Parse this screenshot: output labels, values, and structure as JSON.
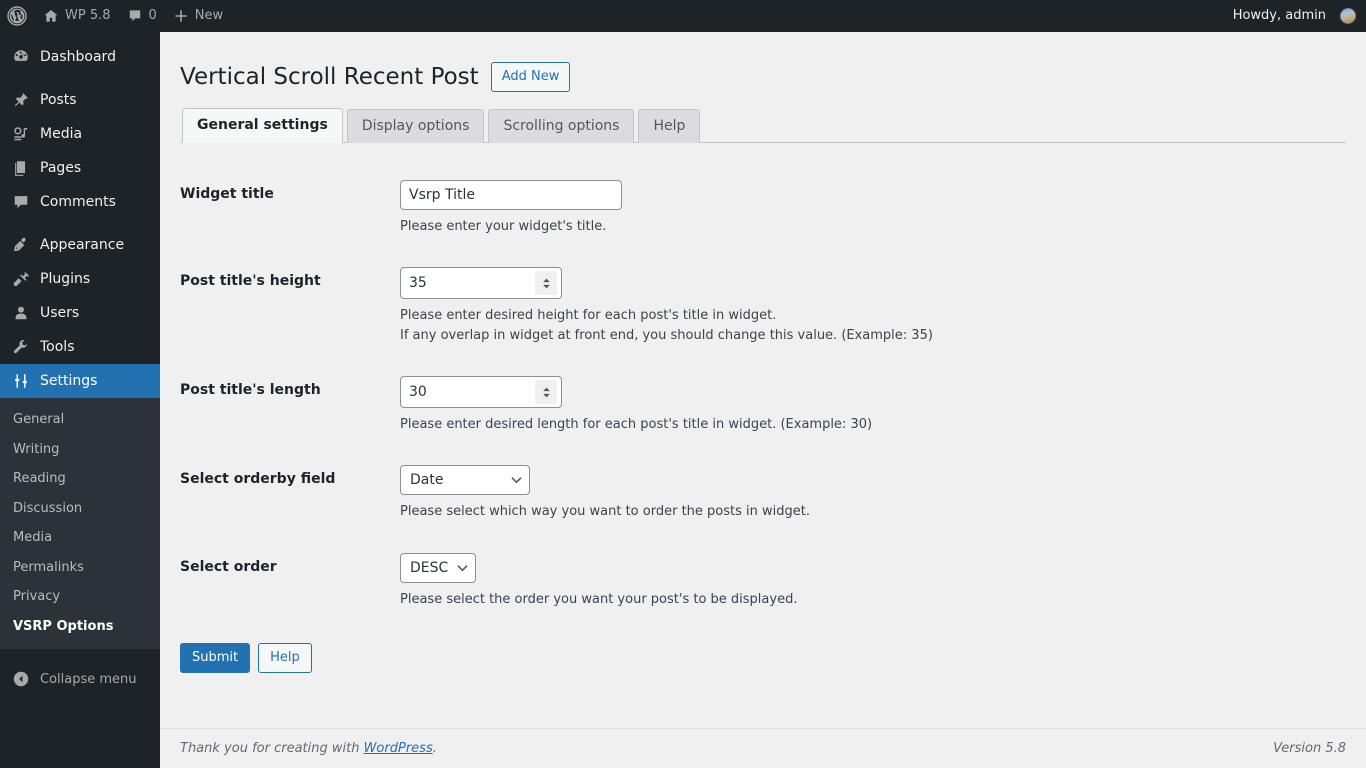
{
  "adminbar": {
    "wp_logo_icon": "wordpress-logo-icon",
    "site_icon": "home-icon",
    "site_name": "WP 5.8",
    "comments_icon": "comment-bubble-icon",
    "comments_count": "0",
    "new_icon": "plus-icon",
    "new_label": "New",
    "howdy": "Howdy, admin",
    "avatar_icon": "avatar-image"
  },
  "sidebar": {
    "items": [
      {
        "label": "Dashboard",
        "icon": "dashboard-icon",
        "current": false
      },
      {
        "label": "Posts",
        "icon": "pin-icon",
        "current": false
      },
      {
        "label": "Media",
        "icon": "media-icon",
        "current": false
      },
      {
        "label": "Pages",
        "icon": "pages-icon",
        "current": false
      },
      {
        "label": "Comments",
        "icon": "comment-bubble-icon",
        "current": false
      },
      {
        "label": "Appearance",
        "icon": "paintbrush-icon",
        "current": false
      },
      {
        "label": "Plugins",
        "icon": "plug-icon",
        "current": false
      },
      {
        "label": "Users",
        "icon": "user-icon",
        "current": false
      },
      {
        "label": "Tools",
        "icon": "wrench-icon",
        "current": false
      },
      {
        "label": "Settings",
        "icon": "sliders-icon",
        "current": true
      }
    ],
    "submenu": [
      {
        "label": "General",
        "current": false
      },
      {
        "label": "Writing",
        "current": false
      },
      {
        "label": "Reading",
        "current": false
      },
      {
        "label": "Discussion",
        "current": false
      },
      {
        "label": "Media",
        "current": false
      },
      {
        "label": "Permalinks",
        "current": false
      },
      {
        "label": "Privacy",
        "current": false
      },
      {
        "label": "VSRP Options",
        "current": true
      }
    ],
    "collapse_label": "Collapse menu",
    "collapse_icon": "chevron-left-circle-icon"
  },
  "page": {
    "title": "Vertical Scroll Recent Post",
    "add_new_label": "Add New",
    "tabs": [
      {
        "label": "General settings",
        "active": true
      },
      {
        "label": "Display options",
        "active": false
      },
      {
        "label": "Scrolling options",
        "active": false
      },
      {
        "label": "Help",
        "active": false
      }
    ]
  },
  "form": {
    "widget_title": {
      "label": "Widget title",
      "value": "Vsrp Title",
      "placeholder": "",
      "desc": "Please enter your widget's title."
    },
    "post_title_height": {
      "label": "Post title's height",
      "value": "35",
      "desc1": "Please enter desired height for each post's title in widget.",
      "desc2": "If any overlap in widget at front end, you should change this value. (Example: 35)"
    },
    "post_title_length": {
      "label": "Post title's length",
      "value": "30",
      "desc1": "Please enter desired length for each post's title in widget. (Example: 30)"
    },
    "orderby": {
      "label": "Select orderby field",
      "value": "Date",
      "desc": "Please select which way you want to order the posts in widget."
    },
    "order": {
      "label": "Select order",
      "value": "DESC",
      "desc": "Please select the order you want your post's to be displayed."
    },
    "submit_label": "Submit",
    "help_label": "Help"
  },
  "footer": {
    "thanks_prefix": "Thank you for creating with ",
    "wordpress_link": "WordPress",
    "thanks_suffix": ".",
    "version": "Version 5.8"
  },
  "colors": {
    "admin_blue": "#2271b1",
    "sidebar_bg": "#1d2327",
    "submenu_bg": "#2c3338",
    "content_bg": "#f0f0f1"
  }
}
